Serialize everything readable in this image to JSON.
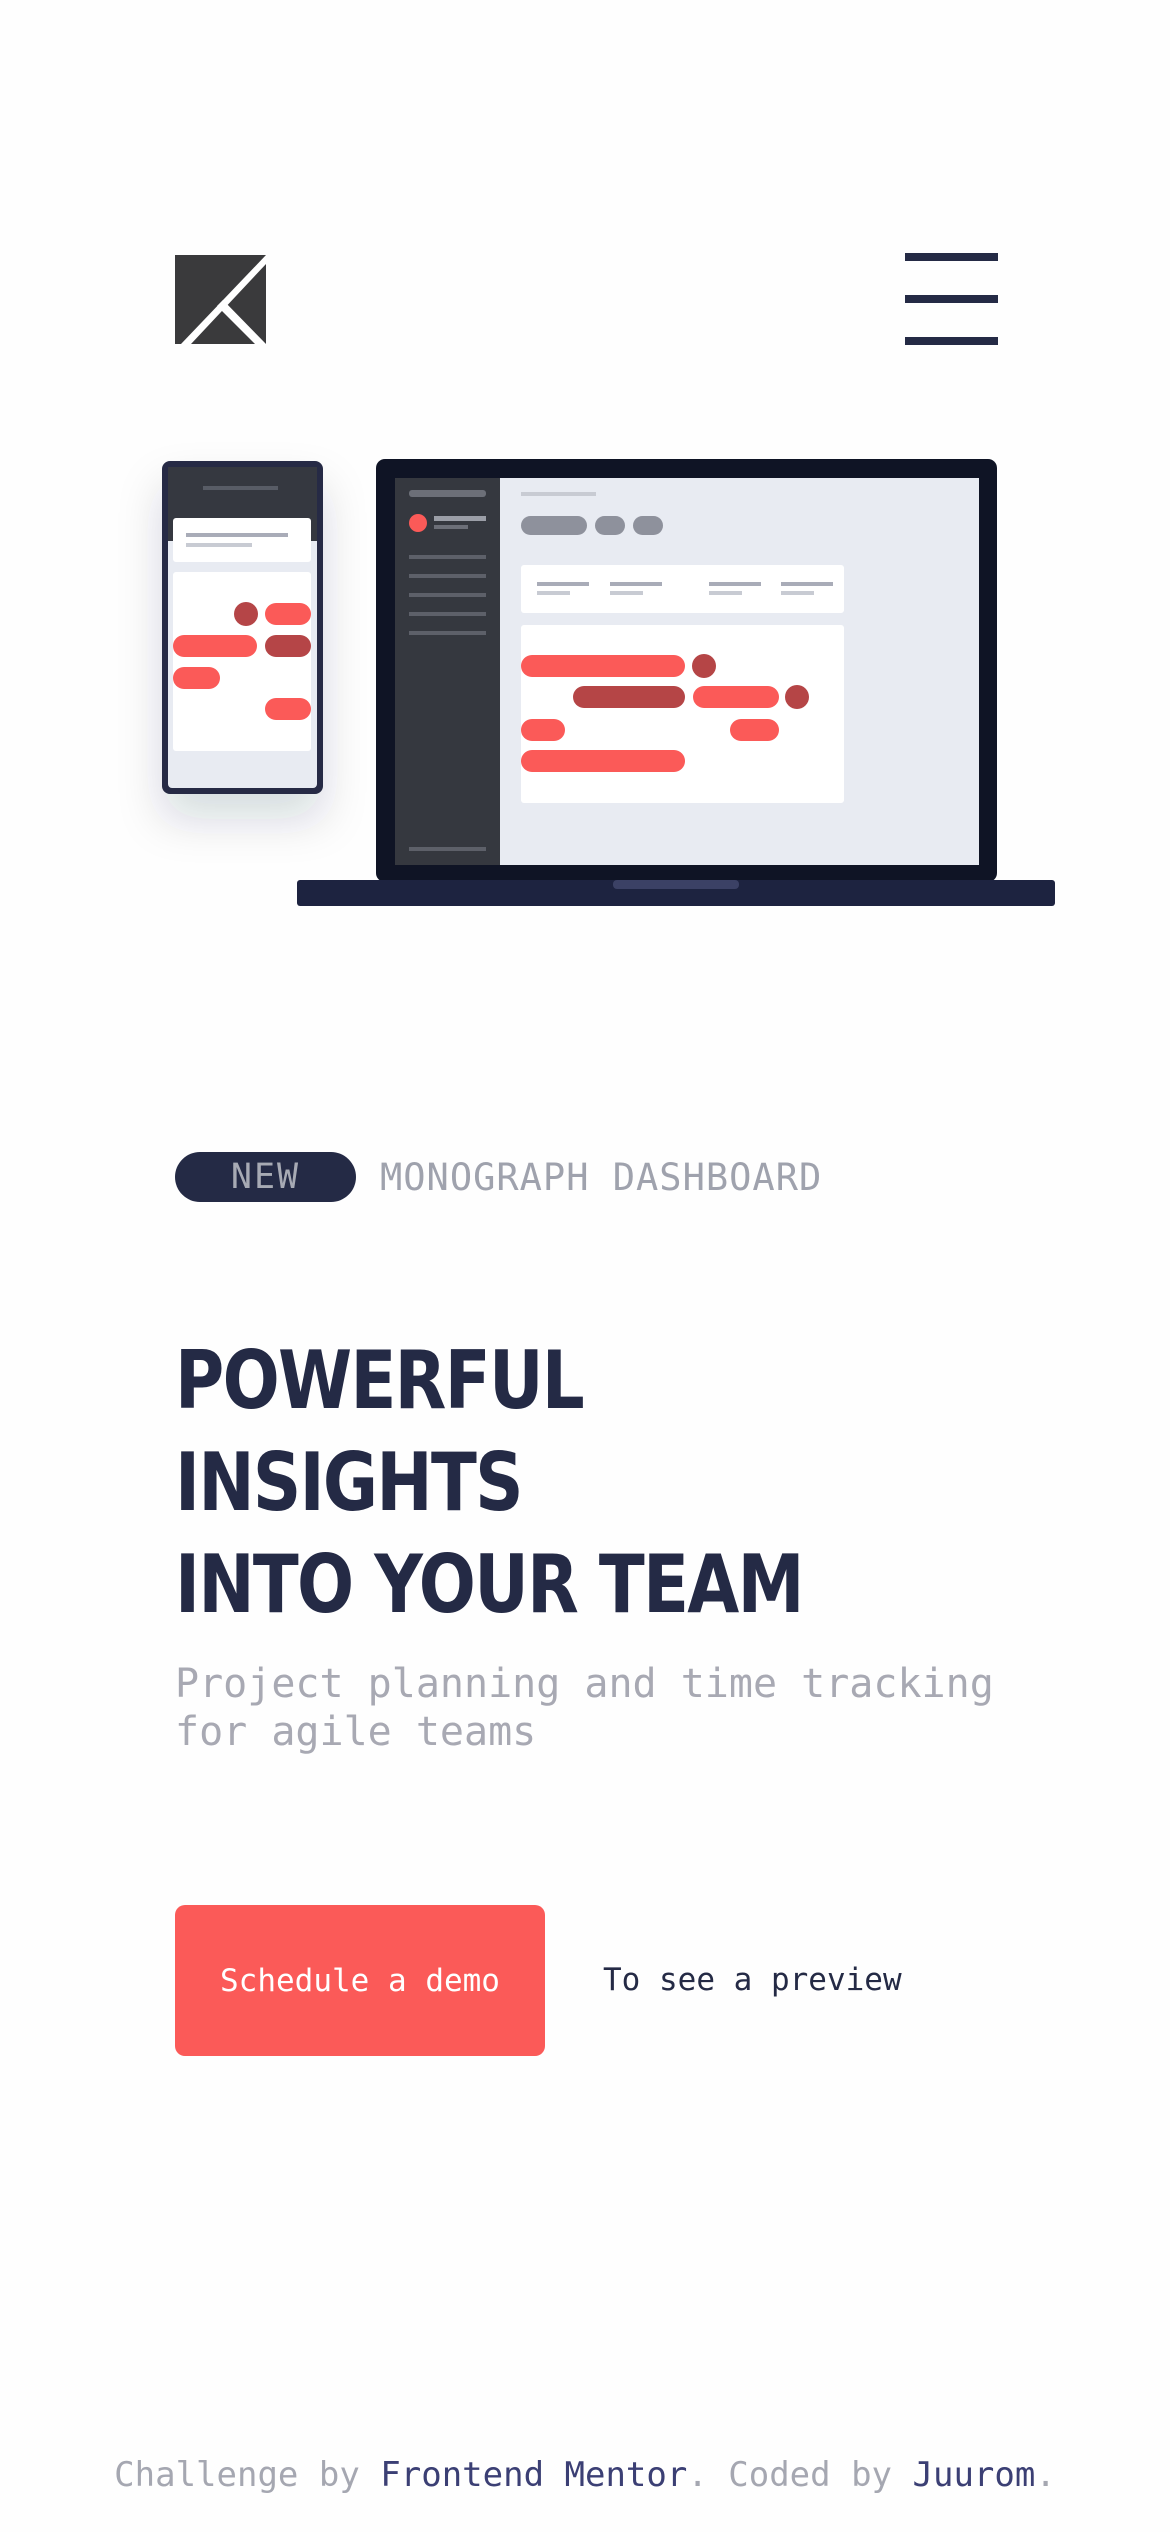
{
  "header": {
    "logo_icon": "k-logo-icon",
    "menu_icon": "hamburger-menu-icon"
  },
  "hero": {
    "badge": "NEW",
    "badge_caption": "MONOGRAPH DASHBOARD",
    "title_line1": "POWERFUL INSIGHTS",
    "title_line2": "INTO YOUR TEAM",
    "subtitle": "Project planning and time tracking for agile teams",
    "cta_label": "Schedule a demo",
    "preview_text": "To see a preview"
  },
  "footer": {
    "prefix": "Challenge by ",
    "link1": "Frontend Mentor",
    "middle": ". Coded by ",
    "link2": "Juurom",
    "suffix": "."
  },
  "colors": {
    "navy": "#242a45",
    "coral": "#fb5a58",
    "dark_red": "#b54546",
    "grey_text": "#a8a9b3"
  }
}
